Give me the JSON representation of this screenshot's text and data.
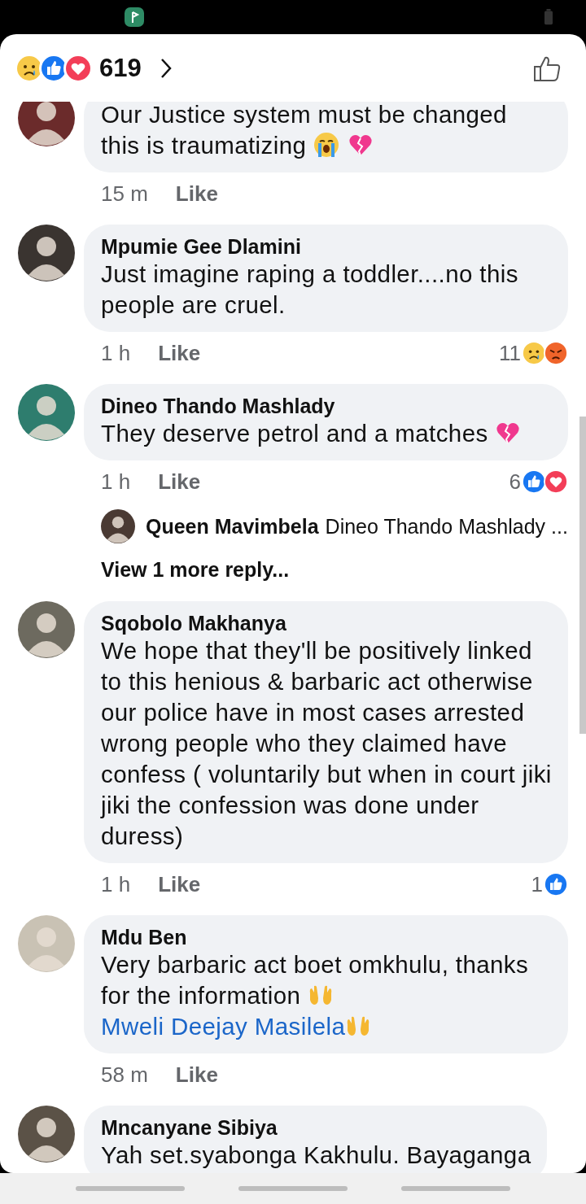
{
  "header": {
    "reactions": [
      {
        "kind": "sad"
      },
      {
        "kind": "like"
      },
      {
        "kind": "love"
      }
    ],
    "count": "619"
  },
  "comments": [
    {
      "body": [
        {
          "kind": "text",
          "text": "Our Justice system must be changed this is traumatizing "
        },
        {
          "kind": "crying"
        },
        {
          "kind": "broken_heart"
        }
      ],
      "time": "15 m",
      "like": "Like"
    },
    {
      "name": "Mpumie Gee Dlamini",
      "body": [
        {
          "kind": "text",
          "text": "Just imagine raping a toddler....no this people are cruel."
        }
      ],
      "time": "1 h",
      "like": "Like",
      "reactions": {
        "count": "11",
        "icons": [
          {
            "kind": "sad"
          },
          {
            "kind": "angry"
          }
        ]
      }
    },
    {
      "name": "Dineo Thando Mashlady",
      "body": [
        {
          "kind": "text",
          "text": "They deserve petrol and a matches "
        },
        {
          "kind": "broken_heart"
        }
      ],
      "time": "1 h",
      "like": "Like",
      "reactions": {
        "count": "6",
        "icons": [
          {
            "kind": "like"
          },
          {
            "kind": "love"
          }
        ]
      },
      "replies": {
        "items": [
          {
            "name": "Queen Mavimbela",
            "text": "Dineo Thando Mashlady ..."
          }
        ],
        "more": "View 1 more reply..."
      }
    },
    {
      "name": "Sqobolo Makhanya",
      "body": [
        {
          "kind": "text",
          "text": "We hope that they'll be positively linked to this henious & barbaric act otherwise our police have in most cases arrested wrong people who they claimed have confess ( voluntarily but when in court jiki jiki the confession was done under duress)"
        }
      ],
      "time": "1 h",
      "like": "Like",
      "reactions": {
        "count": "1",
        "icons": [
          {
            "kind": "like"
          }
        ]
      }
    },
    {
      "name": "Mdu Ben",
      "body": [
        {
          "kind": "text",
          "text": "Very barbaric act boet omkhulu, thanks for the information "
        },
        {
          "kind": "raised_hands"
        },
        {
          "kind": "link",
          "text": "Mweli Deejay Masilela"
        },
        {
          "kind": "raised_hands"
        }
      ],
      "time": "58 m",
      "like": "Like"
    },
    {
      "name": "Mncanyane  Sibiya",
      "body": [
        {
          "kind": "text",
          "text": "Yah set.syabonga Kakhulu. Bayaganga"
        }
      ]
    }
  ]
}
